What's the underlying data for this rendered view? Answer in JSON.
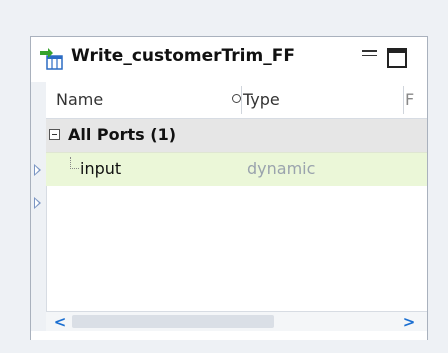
{
  "panel": {
    "title": "Write_customerTrim_FF",
    "title_icon": "write-target-icon",
    "colors": {
      "background": "#eef1f5",
      "selected_row": "#ebf7d8",
      "group_row": "#e6e6e6",
      "scroll_arrow": "#1b6fd1",
      "row_arrow": "#7b96c4"
    }
  },
  "columns": {
    "name": "Name",
    "type": "Type",
    "more": "F"
  },
  "group": {
    "label": "All Ports (1)",
    "expander": "collapse-icon"
  },
  "ports": [
    {
      "name": "input",
      "type": "dynamic"
    }
  ],
  "scrollbar": {
    "left_glyph": "<",
    "right_glyph": ">"
  }
}
